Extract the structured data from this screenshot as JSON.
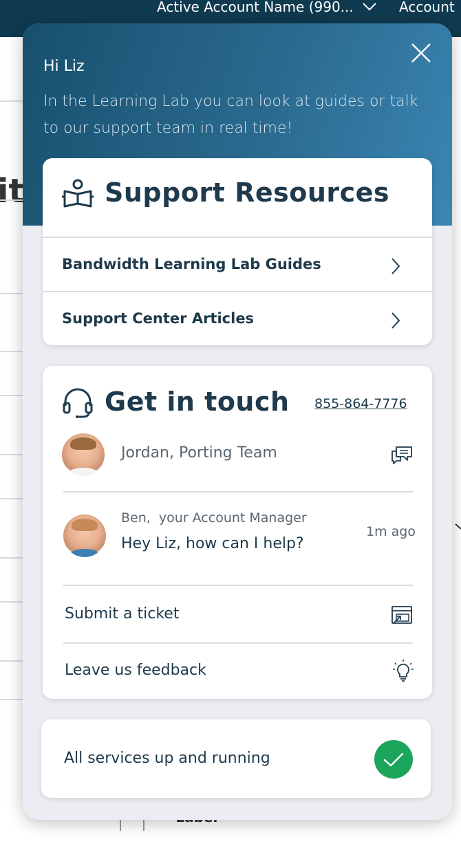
{
  "topbar": {
    "account_name": "Active Account Name (990...",
    "account_label": "Account"
  },
  "background": {
    "title_fragment": "it",
    "bottom_label": "* Label"
  },
  "panel": {
    "greeting": "Hi Liz",
    "intro": "In the Learning Lab you can look at guides or talk to our support team in real time!",
    "support_resources": {
      "title": "Support Resources",
      "links": [
        {
          "label": "Bandwidth Learning Lab Guides"
        },
        {
          "label": "Support Center Articles"
        }
      ]
    },
    "get_in_touch": {
      "title": "Get in touch",
      "phone": "855-864-7776",
      "contacts": [
        {
          "name": "Jordan, Porting Team"
        },
        {
          "name": "Ben,  your Account Manager",
          "message": "Hey Liz, how can I help?",
          "time": "1m ago"
        }
      ],
      "actions": [
        {
          "label": "Submit a ticket"
        },
        {
          "label": "Leave us feedback"
        }
      ]
    },
    "status": {
      "text": "All services up and running"
    }
  },
  "colors": {
    "header_gradient_start": "#17506e",
    "header_gradient_end": "#3a86b4",
    "status_green": "#1aa55b",
    "text_dark": "#1e3a4c"
  }
}
